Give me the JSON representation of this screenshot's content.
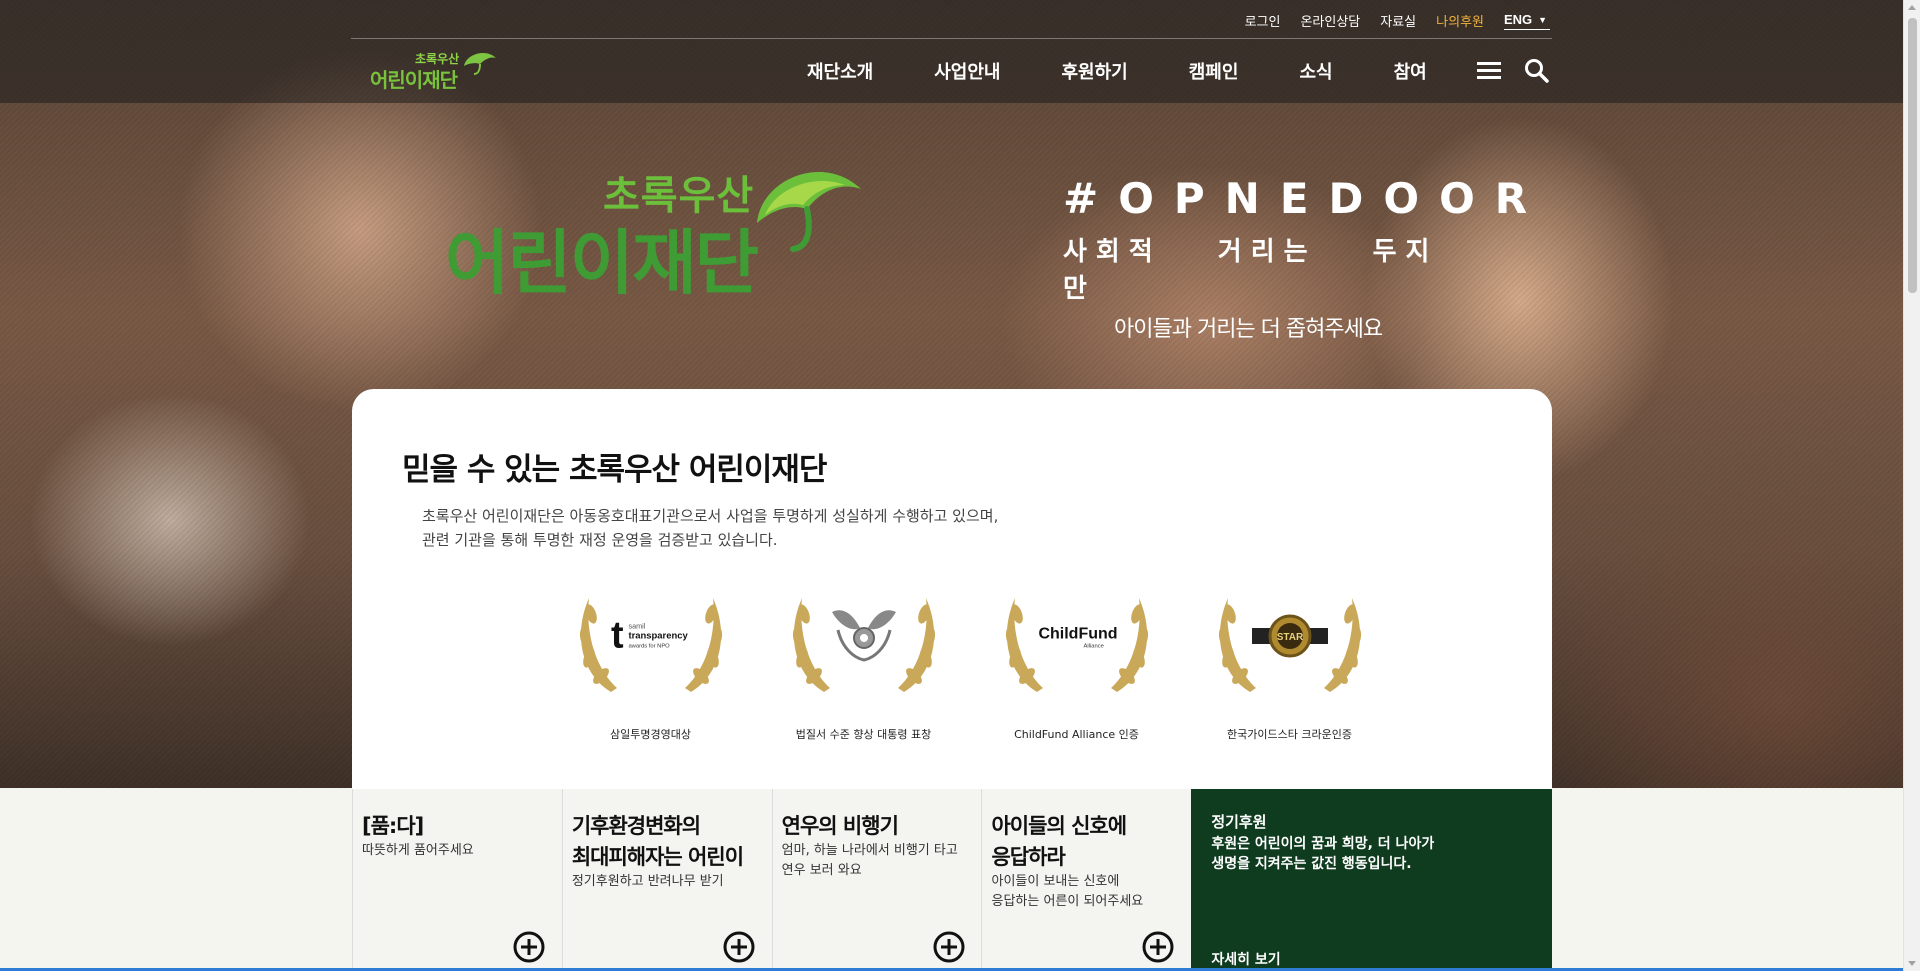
{
  "header": {
    "util_links": [
      "로그인",
      "온라인상담",
      "자료실",
      "나의후원"
    ],
    "lang": "ENG",
    "logo_small_top": "초록우산",
    "logo_small_bottom": "어린이재단",
    "nav": [
      "재단소개",
      "사업안내",
      "후원하기",
      "캠페인",
      "소식",
      "참여"
    ]
  },
  "hero": {
    "logo_top": "초록우산",
    "logo_bottom": "어린이재단",
    "headline": "#OPNEDOOR",
    "line2": "사회적 거리는 두지만",
    "line3": "아이들과 거리는 더 좁혀주세요"
  },
  "trust": {
    "title": "믿을 수 있는 초록우산 어린이재단",
    "desc_line1": "초록우산 어린이재단은 아동옹호대표기관으로서 사업을 투명하게 성실하게 수행하고 있으며,",
    "desc_line2": "관련 기관을 통해 투명한 재정 운영을 검증받고 있습니다.",
    "awards": [
      {
        "caption": "삼일투명경영대상",
        "icon": "transparency-award-icon",
        "badge_big": "t",
        "badge_l1": "samil",
        "badge_l2": "transparency",
        "badge_l3": "awards for NPO"
      },
      {
        "caption": "법질서 수준 향상 대통령 표창",
        "icon": "presidential-emblem-icon"
      },
      {
        "caption": "ChildFund Alliance 인증",
        "icon": "childfund-logo-icon",
        "badge_text": "ChildFund",
        "badge_sub": "Alliance"
      },
      {
        "caption": "한국가이드스타 크라운인증",
        "icon": "guidestar-crown-icon",
        "badge_text": "STAR"
      }
    ]
  },
  "tiles": [
    {
      "title_l1": "[품:다]",
      "title_l2": "",
      "sub_l1": "따뜻하게 품어주세요",
      "sub_l2": ""
    },
    {
      "title_l1": "기후환경변화의",
      "title_l2": "최대피해자는 어린이",
      "sub_l1": "정기후원하고 반려나무 받기",
      "sub_l2": ""
    },
    {
      "title_l1": "연우의 비행기",
      "title_l2": "",
      "sub_l1": "엄마, 하늘 나라에서 비행기 타고",
      "sub_l2": "연우 보러 와요"
    },
    {
      "title_l1": "아이들의 신호에",
      "title_l2": "응답하라",
      "sub_l1": "아이들이 보내는 신호에",
      "sub_l2": "응답하는 어른이 되어주세요"
    }
  ],
  "donate": {
    "title": "정기후원",
    "desc_l1": "후원은 어린이의 꿈과 희망, 더 나아가",
    "desc_l2": "생명을 지켜주는 값진 행동입니다.",
    "more": "자세히 보기"
  },
  "colors": {
    "accent_green": "#0f3b1f",
    "logo_green": "#3f9c35",
    "util_highlight": "#f0b23a",
    "gold": "#c9a85a"
  }
}
